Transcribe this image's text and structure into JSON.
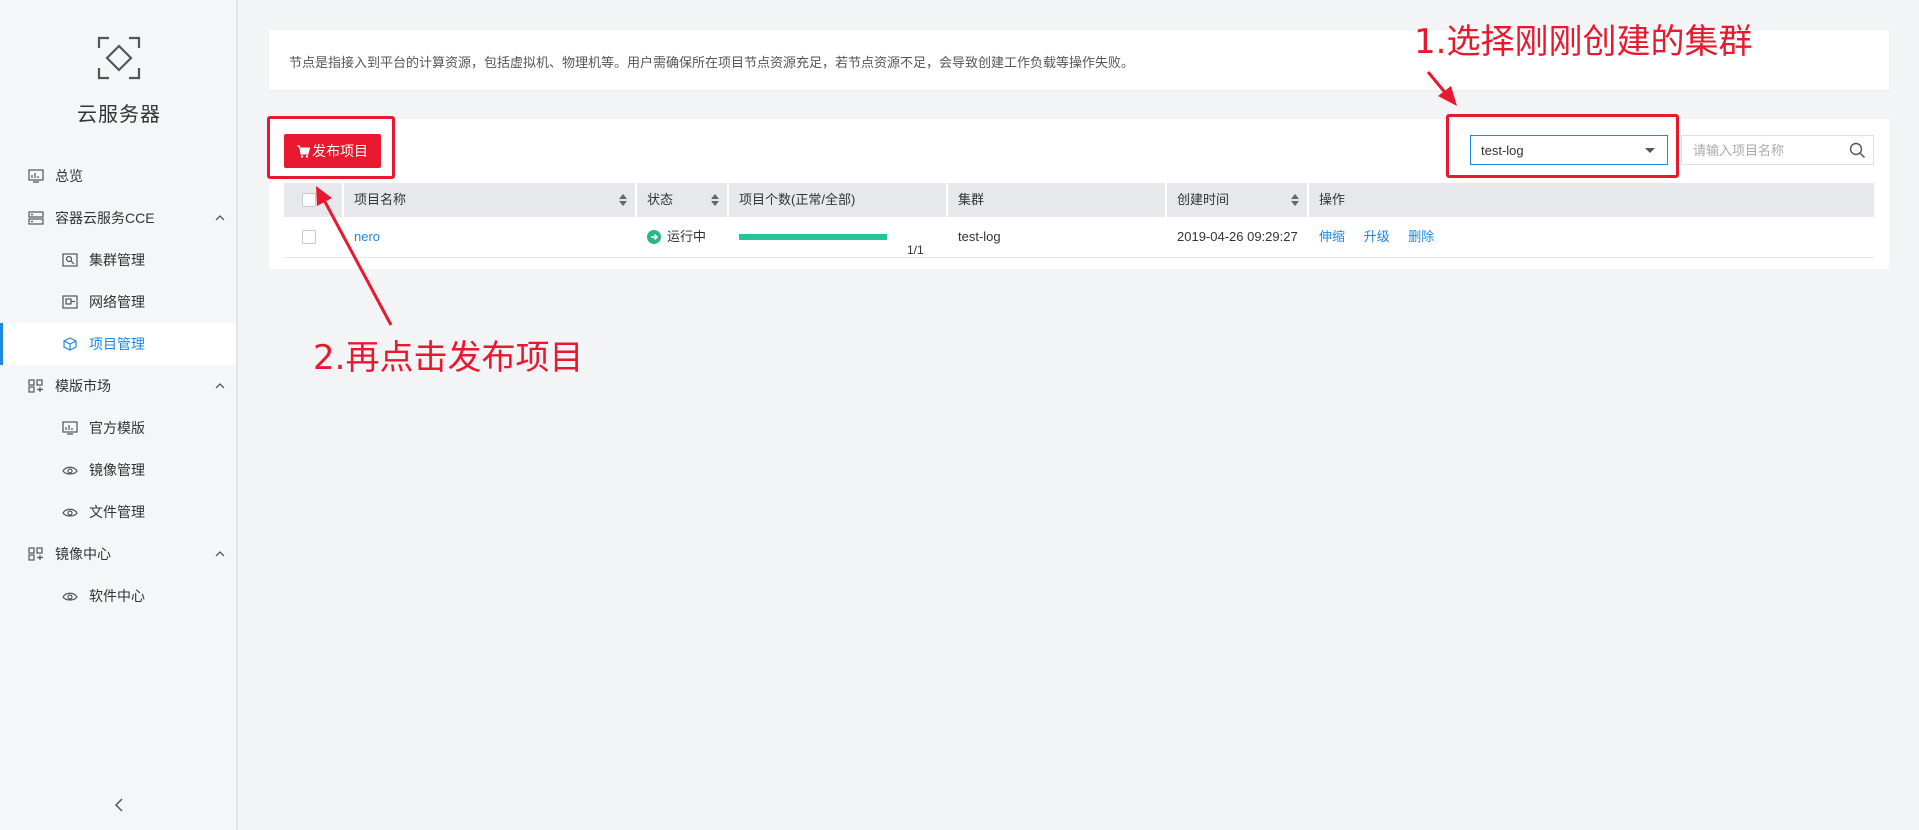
{
  "app": {
    "title": "云服务器"
  },
  "sidebar": {
    "items": [
      {
        "label": "总览",
        "icon": "monitor-chart-icon"
      },
      {
        "label": "容器云服务CCE",
        "icon": "server-stack-icon",
        "expanded": true
      },
      {
        "label": "集群管理",
        "icon": "cluster-search-icon"
      },
      {
        "label": "网络管理",
        "icon": "network-icon"
      },
      {
        "label": "项目管理",
        "icon": "cube-project-icon",
        "active": true
      },
      {
        "label": "模版市场",
        "icon": "grid-apps-icon",
        "expanded": true
      },
      {
        "label": "官方模版",
        "icon": "monitor-chart-icon"
      },
      {
        "label": "镜像管理",
        "icon": "eye-image-icon"
      },
      {
        "label": "文件管理",
        "icon": "eye-image-icon"
      },
      {
        "label": "镜像中心",
        "icon": "grid-apps-icon",
        "expanded": true
      },
      {
        "label": "软件中心",
        "icon": "eye-image-icon"
      }
    ]
  },
  "notice": {
    "text": "节点是指接入到平台的计算资源，包括虚拟机、物理机等。用户需确保所在项目节点资源充足，若节点资源不足，会导致创建工作负载等操作失败。"
  },
  "toolbar": {
    "publish_label": "发布项目",
    "cluster_value": "test-log",
    "search_placeholder": "请输入项目名称"
  },
  "table": {
    "columns": [
      "项目名称",
      "状态",
      "项目个数(正常/全部)",
      "集群",
      "创建时间",
      "操作"
    ],
    "rows": [
      {
        "name": "nero",
        "status": "运行中",
        "ratio": "1/1",
        "ratio_fraction": 1.0,
        "cluster": "test-log",
        "created": "2019-04-26 09:29:27",
        "actions": [
          "伸缩",
          "升级",
          "删除"
        ]
      }
    ]
  },
  "annotations": {
    "step1": "1.选择刚刚创建的集群",
    "step2": "2.再点击发布项目",
    "color": "#e8192e"
  },
  "colors": {
    "accent": "#1e88e5",
    "brand_red": "#e8192e",
    "status_green": "#2bb58a"
  }
}
